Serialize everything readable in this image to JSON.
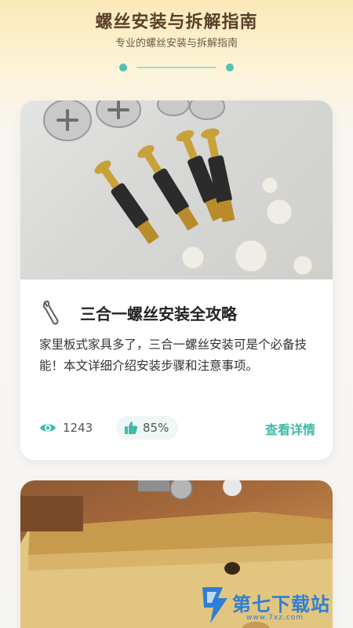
{
  "header": {
    "title": "螺丝安装与拆解指南",
    "subtitle": "专业的螺丝安装与拆解指南"
  },
  "colors": {
    "accent": "#3fbaa5",
    "title_brown": "#5a3f2a",
    "header_bg": "#fbe9b8"
  },
  "articles": [
    {
      "image": "furniture-screws-photo",
      "icon": "wrench-icon",
      "title": "三合一螺丝安装全攻略",
      "description": "家里板式家具多了，三合一螺丝安装可是个必备技能！本文详细介绍安装步骤和注意事项。",
      "views": "1243",
      "likes": "85%",
      "detail_label": "查看详情"
    },
    {
      "image": "wood-board-photo"
    }
  ],
  "watermark": {
    "text": "第七下载站",
    "sub": "www.7xz.com"
  }
}
